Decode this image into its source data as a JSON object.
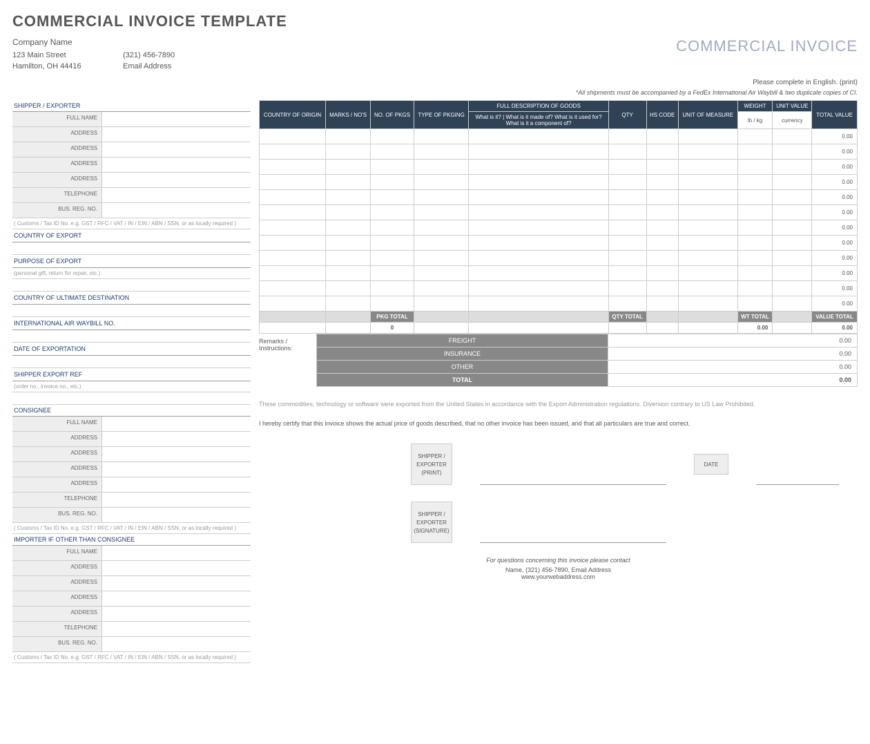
{
  "title": "COMMERCIAL INVOICE TEMPLATE",
  "docTitle": "COMMERCIAL INVOICE",
  "company": {
    "name": "Company Name",
    "street": "123 Main Street",
    "phone": "(321) 456-7890",
    "cityline": "Hamilton, OH  44416",
    "email": "Email Address"
  },
  "notes": {
    "english": "Please complete in English. (print)",
    "shipments": "*All shipments must be accompanied by a FedEx International Air Waybill & two duplicate copies of CI."
  },
  "left": {
    "shipperExporter": "SHIPPER / EXPORTER",
    "fields": {
      "fullName": "FULL NAME",
      "address": "ADDRESS",
      "telephone": "TELEPHONE",
      "busRegNo": "BUS. REG. NO."
    },
    "customsHint": "( Customs / Tax ID No. e.g. GST / RFC / VAT / IN / EIN / ABN / SSN, or as locally required )",
    "countryExport": "COUNTRY OF EXPORT",
    "purposeExport": "PURPOSE OF EXPORT",
    "purposeHint": "(personal gift, return for repair, etc.)",
    "countryDest": "COUNTRY OF ULTIMATE DESTINATION",
    "airWaybill": "INTERNATIONAL AIR WAYBILL NO.",
    "dateExport": "DATE OF EXPORTATION",
    "shipperRef": "SHIPPER EXPORT REF",
    "shipperRefHint": "(order no., invoice no., etc.)",
    "consignee": "CONSIGNEE",
    "importer": "IMPORTER IF OTHER THAN CONSIGNEE"
  },
  "itemsHeader": {
    "country": "COUNTRY OF ORIGIN",
    "marks": "MARKS / NO'S",
    "noPkgs": "NO. OF PKGS",
    "typePkg": "TYPE OF PKGING",
    "fullDesc": "FULL DESCRIPTION OF GOODS",
    "descHint1": "What is it? | What is it made of? What is it used for?",
    "descHint2": "What is it a component of?",
    "qty": "QTY",
    "hsCode": "HS CODE",
    "unitMeasure": "UNIT OF MEASURE",
    "weight": "WEIGHT",
    "weightUnit": "lb / kg",
    "unitValue": "UNIT VALUE",
    "currency": "currency",
    "totalValue": "TOTAL VALUE"
  },
  "itemRows": [
    {
      "total": "0.00"
    },
    {
      "total": "0.00"
    },
    {
      "total": "0.00"
    },
    {
      "total": "0.00"
    },
    {
      "total": "0.00"
    },
    {
      "total": "0.00"
    },
    {
      "total": "0.00"
    },
    {
      "total": "0.00"
    },
    {
      "total": "0.00"
    },
    {
      "total": "0.00"
    },
    {
      "total": "0.00"
    },
    {
      "total": "0.00"
    }
  ],
  "totals": {
    "pkgTotalLabel": "PKG TOTAL",
    "pkgTotal": "0",
    "qtyTotalLabel": "QTY TOTAL",
    "wtTotalLabel": "WT TOTAL",
    "wtTotal": "0.00",
    "valueTotalLabel": "VALUE TOTAL",
    "valueTotal": "0.00"
  },
  "footerTotals": {
    "remarks": "Remarks / Instructions:",
    "freight": "FREIGHT",
    "freightVal": "0.00",
    "insurance": "INSURANCE",
    "insuranceVal": "0.00",
    "other": "OTHER",
    "otherVal": "0.00",
    "total": "TOTAL",
    "totalVal": "0.00"
  },
  "legal": "These commodities, technology or software were exported from the United States in accordance with the Export Administration regulations.  Diversion contrary to US Law Prohibited.",
  "certify": "I hereby certify that this invoice shows the actual price of goods described, that no other invoice has been issued, and that all particulars are true and correct.",
  "sig": {
    "printLabel1": "SHIPPER /",
    "printLabel2": "EXPORTER",
    "printLabel3": "(PRINT)",
    "sigLabel3": "(SIGNATURE)",
    "date": "DATE"
  },
  "contact": {
    "line1": "For questions concerning this invoice please contact",
    "line2": "Name, (321) 456-7890, Email Address",
    "line3": "www.yourwebaddress.com"
  }
}
